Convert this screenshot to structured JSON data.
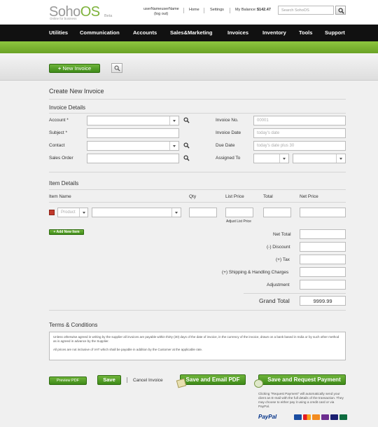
{
  "header": {
    "logo_main": "Soho",
    "logo_accent": "OS",
    "logo_tagline": "Online for business",
    "logo_beta": "Beta",
    "username": "userNameuserName",
    "logout": "(log out)",
    "home": "Home",
    "settings": "Settings",
    "balance_label": "My Balance:",
    "balance_value": "$142.47",
    "search_placeholder": "Search SohoOS"
  },
  "nav": [
    "Utilities",
    "Communication",
    "Accounts",
    "Sales&Marketing",
    "Invoices",
    "Inventory",
    "Tools",
    "Support"
  ],
  "toolbar": {
    "new_invoice": "New Invoice"
  },
  "page_title": "Create New Invoice",
  "invoice_details": {
    "title": "Invoice Details",
    "account": "Account *",
    "subject": "Subject *",
    "contact": "Contact",
    "sales_order": "Sales Order",
    "invoice_no": "Invoice No.",
    "invoice_no_placeholder": "00001",
    "invoice_date": "Invoice Date",
    "invoice_date_placeholder": "today's date",
    "due_date": "Due Date",
    "due_date_placeholder": "today's date plus 30",
    "assigned_to": "Assigned To"
  },
  "item_details": {
    "title": "Item Details",
    "col_item": "Item Name",
    "col_qty": "Qty",
    "col_list_price": "List Price",
    "col_total": "Total",
    "col_net_price": "Net Price",
    "product_placeholder": "Product",
    "adjust_list_price": "Adjust List Price",
    "add_new_item": "Add New Item"
  },
  "totals": {
    "net_total": "Net Total",
    "discount": "(-) Discount",
    "tax": "(+) Tax",
    "shipping": "(+) Shipping & Handling Charges",
    "adjustment": "Adjustment",
    "grand_total": "Grand Total",
    "grand_total_value": "9999.99"
  },
  "terms": {
    "title": "Terms & Conditions",
    "text1": "Unless otherwise agreed in writing by the supplier all invoices are payable within thirty (30) days of the date of invoice, in the currency of the invoice, drawn on a bank based in India or by such other method as is agreed in advance by the Supplier.",
    "text2": "All prices are not inclusive of VAT which shall be payable in addition by the Customer at the applicable rate."
  },
  "actions": {
    "preview_pdf": "Preview PDF",
    "save": "Save",
    "cancel": "Cancel Invoice",
    "save_email_pdf": "Save and Email PDF",
    "save_request_payment": "Save and Request Payment",
    "note": "Clicking \"Request Payment\" will automatically send your client an E-mail with the full details of the transaction. They may choose to either pay it using a credit card or via PayPal.",
    "paypal": "PayPal"
  },
  "colors": {
    "accent_green": "#6aa225",
    "nav_bg": "#111111",
    "remove_red": "#c0392b"
  }
}
